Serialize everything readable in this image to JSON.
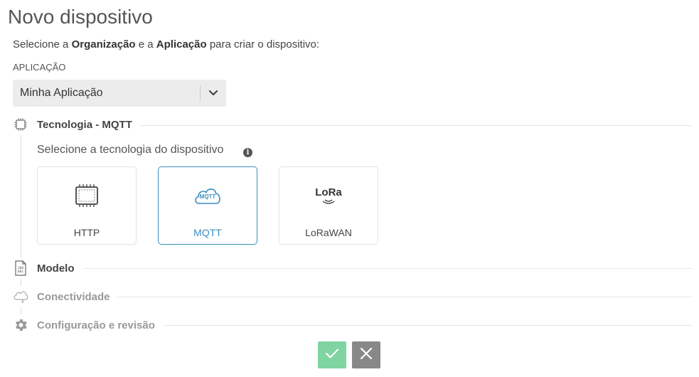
{
  "page": {
    "title": "Novo dispositivo"
  },
  "subtitle": {
    "part1": "Selecione a ",
    "org": "Organização",
    "part2": " e a ",
    "app": "Aplicação",
    "part3": " para criar o dispositivo:"
  },
  "application": {
    "label": "APLICAÇÃO",
    "selected": "Minha Aplicação"
  },
  "steps": [
    {
      "label": "Tecnologia - MQTT",
      "icon": "chip-icon",
      "state": "active"
    },
    {
      "label": "Modelo",
      "icon": "document-icon",
      "state": "pending"
    },
    {
      "label": "Conectividade",
      "icon": "cloud-icon",
      "state": "disabled"
    },
    {
      "label": "Configuração e revisão",
      "icon": "gear-icon",
      "state": "disabled"
    }
  ],
  "technology": {
    "prompt": "Selecione a tecnologia do dispositivo",
    "info": "i",
    "options": [
      {
        "label": "HTTP",
        "icon": "chip-icon",
        "selected": false
      },
      {
        "label": "MQTT",
        "icon_text": "MQTT",
        "icon": "mqtt-cloud-icon",
        "selected": true
      },
      {
        "label": "LoRaWAN",
        "icon_text": "LoRa",
        "icon": "lora-icon",
        "selected": false
      }
    ]
  },
  "actions": {
    "confirm": "check-icon",
    "cancel": "close-icon"
  },
  "colors": {
    "accent": "#3b8fbf",
    "confirm": "#7fd4a1",
    "cancel": "#888888"
  }
}
